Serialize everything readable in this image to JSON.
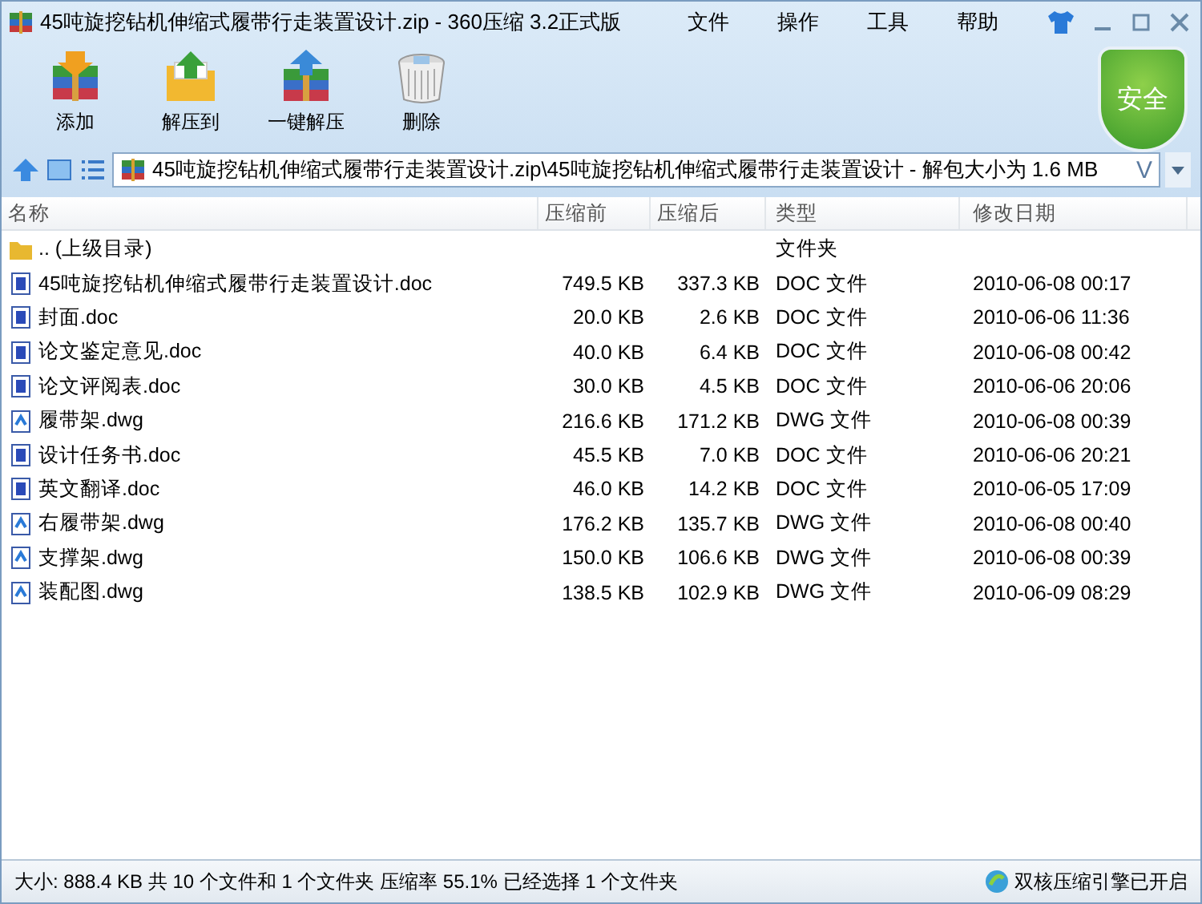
{
  "window": {
    "title": "45吨旋挖钻机伸缩式履带行走装置设计.zip - 360压缩 3.2正式版"
  },
  "menu": [
    "文件",
    "操作",
    "工具",
    "帮助"
  ],
  "toolbar": [
    {
      "kind": "add",
      "label": "添加"
    },
    {
      "kind": "extract",
      "label": "解压到"
    },
    {
      "kind": "oneclick",
      "label": "一键解压"
    },
    {
      "kind": "delete",
      "label": "删除"
    }
  ],
  "security_badge": {
    "label": "安全"
  },
  "address": {
    "path": "45吨旋挖钻机伸缩式履带行走装置设计.zip\\45吨旋挖钻机伸缩式履带行走装置设计 - 解包大小为 1.6 MB",
    "mark": "V"
  },
  "table": {
    "columns": [
      "名称",
      "压缩前",
      "压缩后",
      "类型",
      "修改日期"
    ],
    "rows": [
      {
        "kind": "folder",
        "name": ".. (上级目录)",
        "size": "",
        "packed": "",
        "type": "文件夹",
        "modified": ""
      },
      {
        "kind": "doc",
        "name": "45吨旋挖钻机伸缩式履带行走装置设计.doc",
        "size": "749.5 KB",
        "packed": "337.3 KB",
        "type": "DOC 文件",
        "modified": "2010-06-08 00:17"
      },
      {
        "kind": "doc",
        "name": "封面.doc",
        "size": "20.0 KB",
        "packed": "2.6 KB",
        "type": "DOC 文件",
        "modified": "2010-06-06 11:36"
      },
      {
        "kind": "doc",
        "name": "论文鉴定意见.doc",
        "size": "40.0 KB",
        "packed": "6.4 KB",
        "type": "DOC 文件",
        "modified": "2010-06-08 00:42"
      },
      {
        "kind": "doc",
        "name": "论文评阅表.doc",
        "size": "30.0 KB",
        "packed": "4.5 KB",
        "type": "DOC 文件",
        "modified": "2010-06-06 20:06"
      },
      {
        "kind": "dwg",
        "name": "履带架.dwg",
        "size": "216.6 KB",
        "packed": "171.2 KB",
        "type": "DWG 文件",
        "modified": "2010-06-08 00:39"
      },
      {
        "kind": "doc",
        "name": "设计任务书.doc",
        "size": "45.5 KB",
        "packed": "7.0 KB",
        "type": "DOC 文件",
        "modified": "2010-06-06 20:21"
      },
      {
        "kind": "doc",
        "name": "英文翻译.doc",
        "size": "46.0 KB",
        "packed": "14.2 KB",
        "type": "DOC 文件",
        "modified": "2010-06-05 17:09"
      },
      {
        "kind": "dwg",
        "name": "右履带架.dwg",
        "size": "176.2 KB",
        "packed": "135.7 KB",
        "type": "DWG 文件",
        "modified": "2010-06-08 00:40"
      },
      {
        "kind": "dwg",
        "name": "支撑架.dwg",
        "size": "150.0 KB",
        "packed": "106.6 KB",
        "type": "DWG 文件",
        "modified": "2010-06-08 00:39"
      },
      {
        "kind": "dwg",
        "name": "装配图.dwg",
        "size": "138.5 KB",
        "packed": "102.9 KB",
        "type": "DWG 文件",
        "modified": "2010-06-09 08:29"
      }
    ]
  },
  "status_bar": {
    "text": "大小: 888.4 KB 共 10 个文件和 1 个文件夹 压缩率 55.1% 已经选择 1 个文件夹",
    "engine": "双核压缩引擎已开启"
  }
}
